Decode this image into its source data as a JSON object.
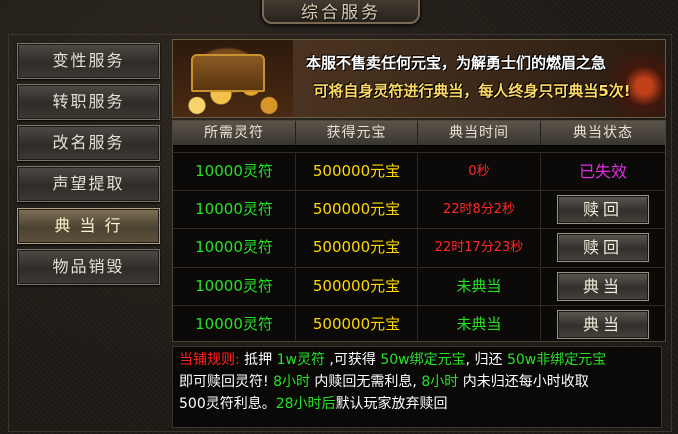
{
  "window": {
    "title": "综合服务"
  },
  "sidebar": {
    "items": [
      {
        "label": "变性服务",
        "active": false
      },
      {
        "label": "转职服务",
        "active": false
      },
      {
        "label": "改名服务",
        "active": false
      },
      {
        "label": "声望提取",
        "active": false
      },
      {
        "label": "典 当 行",
        "active": true
      },
      {
        "label": "物品销毁",
        "active": false
      }
    ]
  },
  "banner": {
    "line1": "本服不售卖任何元宝，为解勇士们的燃眉之急",
    "line2": "可将自身灵符进行典当，每人终身只可典当5次!"
  },
  "table": {
    "headers": [
      "所需灵符",
      "获得元宝",
      "典当时间",
      "典当状态"
    ],
    "rows": [
      {
        "cost": "10000灵符",
        "gain": "500000元宝",
        "time": "0秒",
        "time_color": "red",
        "status": "已失效",
        "status_type": "text"
      },
      {
        "cost": "10000灵符",
        "gain": "500000元宝",
        "time": "22时8分2秒",
        "time_color": "red",
        "status": "赎回",
        "status_type": "button"
      },
      {
        "cost": "10000灵符",
        "gain": "500000元宝",
        "time": "22时17分23秒",
        "time_color": "red",
        "status": "赎回",
        "status_type": "button"
      },
      {
        "cost": "10000灵符",
        "gain": "500000元宝",
        "time": "未典当",
        "time_color": "green",
        "status": "典当",
        "status_type": "button"
      },
      {
        "cost": "10000灵符",
        "gain": "500000元宝",
        "time": "未典当",
        "time_color": "green",
        "status": "典当",
        "status_type": "button"
      }
    ]
  },
  "rules": {
    "prefix": "当铺规则:",
    "t1": " 抵押 ",
    "g1": "1w灵符",
    "t2": " ,可获得 ",
    "g2": "50w绑定元宝",
    "t3": ", 归还 ",
    "g3": "50w非绑定元宝",
    "t4": "即可赎回灵符! ",
    "g4": "8小时",
    "t5": " 内赎回无需利息, ",
    "g5": "8小时",
    "t6": " 内未归还每小时收取",
    "t7": "500灵符利息。",
    "g6": "28小时后",
    "t8": "默认玩家放弃赎回"
  },
  "colors": {
    "green": "#27e027",
    "yellow": "#ffd800",
    "red": "#ff2a2a",
    "magenta": "#e22fe2"
  }
}
